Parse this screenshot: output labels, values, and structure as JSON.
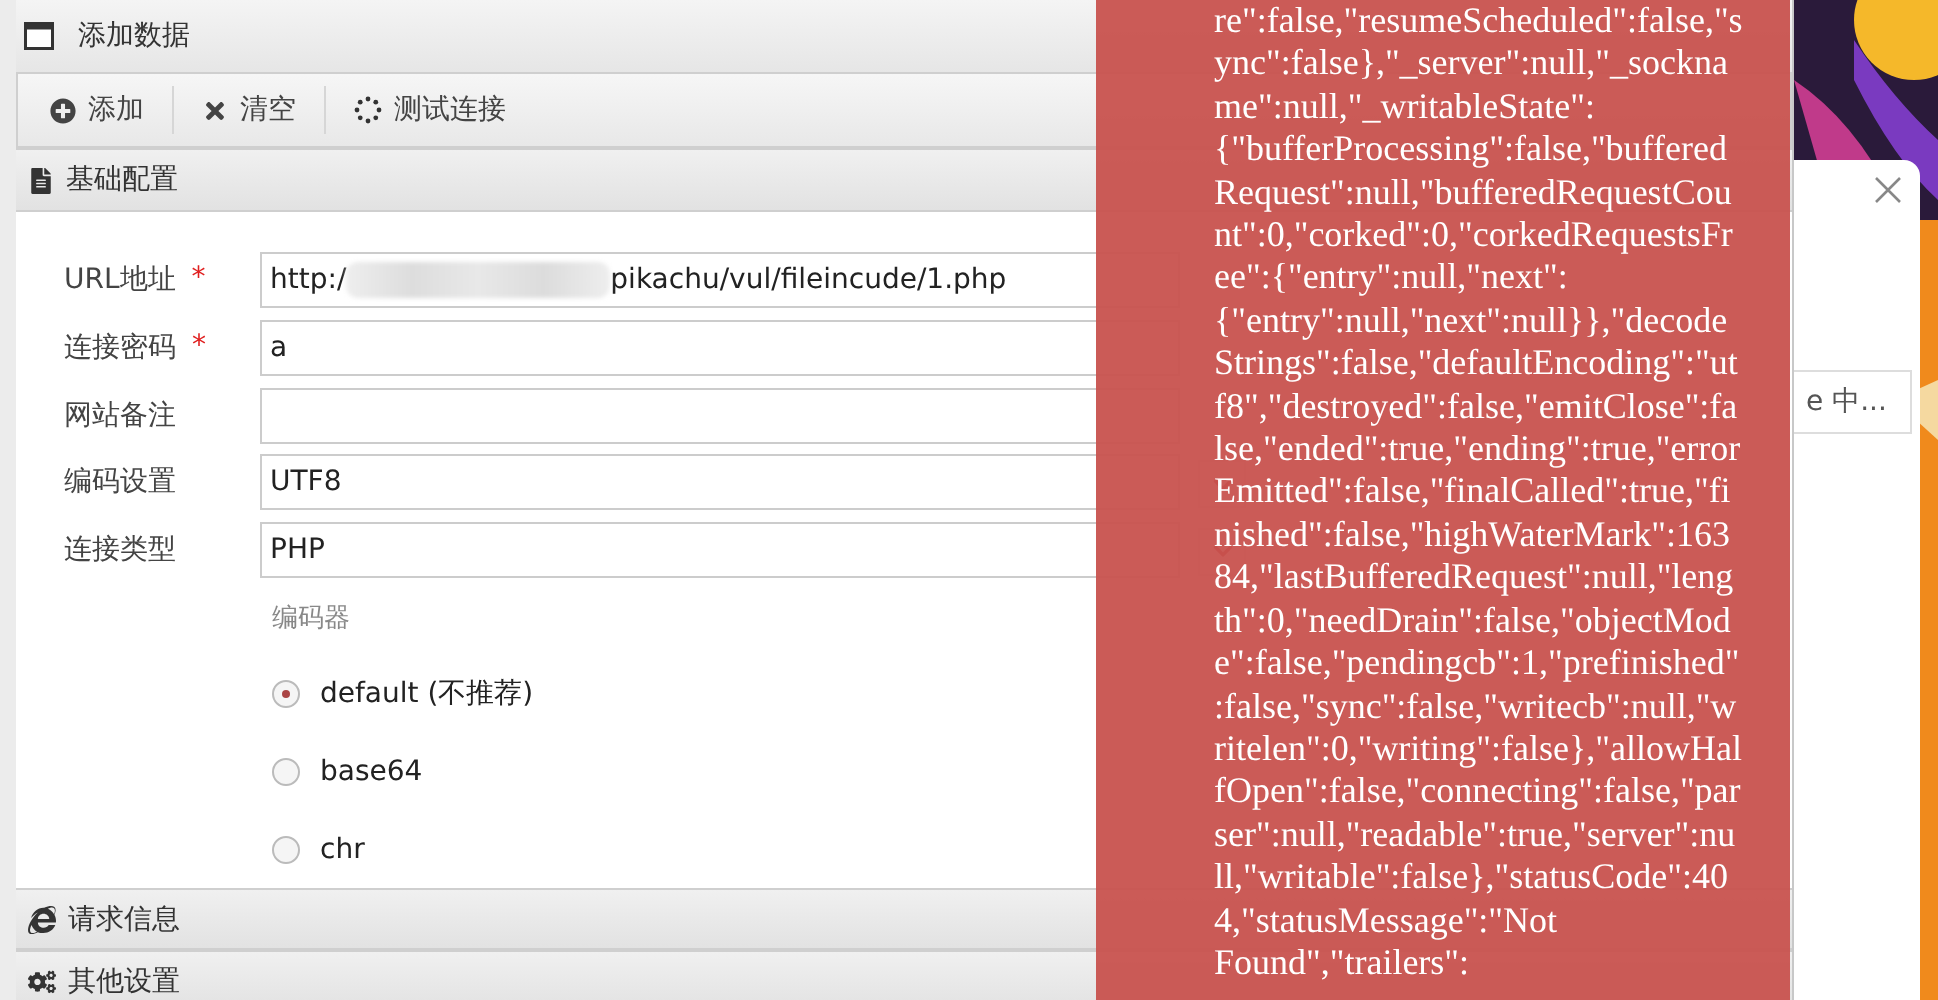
{
  "window": {
    "title": "添加数据"
  },
  "toolbar": [
    {
      "kind": "add",
      "label": "添加"
    },
    {
      "kind": "clear",
      "label": "清空"
    },
    {
      "kind": "test",
      "label": "测试连接"
    }
  ],
  "sections": [
    {
      "kind": "basic",
      "title": "基础配置"
    },
    {
      "kind": "request",
      "title": "请求信息"
    },
    {
      "kind": "other",
      "title": "其他设置"
    }
  ],
  "form": {
    "fields": [
      {
        "kind": "redacted",
        "label": "URL地址",
        "required_mark": "*",
        "value_start": "http:/",
        "value_end": "pikachu/vul/fileincude/1.php"
      },
      {
        "kind": "text",
        "label": "连接密码",
        "required_mark": "*",
        "value": "a"
      },
      {
        "kind": "text",
        "label": "网站备注"
      },
      {
        "kind": "select",
        "label": "编码设置",
        "value": "UTF8"
      },
      {
        "kind": "select",
        "label": "连接类型",
        "value": "PHP"
      }
    ],
    "encoder": {
      "label": "编码器",
      "options": [
        {
          "label": "default (不推荐)",
          "selected": true
        },
        {
          "label": "base64",
          "selected": false
        },
        {
          "label": "chr",
          "selected": false
        }
      ]
    }
  },
  "error_toast": {
    "lines": [
      "re\":false,\"resumeScheduled\":false,\"s",
      "ync\":false},\"_server\":null,\"_sockna",
      "me\":null,\"_writableState\":",
      "{\"bufferProcessing\":false,\"buffered",
      "Request\":null,\"bufferedRequestCou",
      "nt\":0,\"corked\":0,\"corkedRequestsFr",
      "ee\":{\"entry\":null,\"next\":",
      "{\"entry\":null,\"next\":null}},\"decode",
      "Strings\":false,\"defaultEncoding\":\"ut",
      "f8\",\"destroyed\":false,\"emitClose\":fa",
      "lse,\"ended\":true,\"ending\":true,\"error",
      "Emitted\":false,\"finalCalled\":true,\"fi",
      "nished\":false,\"highWaterMark\":163",
      "84,\"lastBufferedRequest\":null,\"leng",
      "th\":0,\"needDrain\":false,\"objectMod",
      "e\":false,\"pendingcb\":1,\"prefinished\"",
      ":false,\"sync\":false,\"writecb\":null,\"w",
      "ritelen\":0,\"writing\":false},\"allowHal",
      "fOpen\":false,\"connecting\":false,\"par",
      "ser\":null,\"readable\":true,\"server\":nu",
      "ll,\"writable\":false},\"statusCode\":40",
      "4,\"statusMessage\":\"Not",
      "Found\",\"trailers\":"
    ]
  },
  "background_window": {
    "text": "e 中..."
  }
}
